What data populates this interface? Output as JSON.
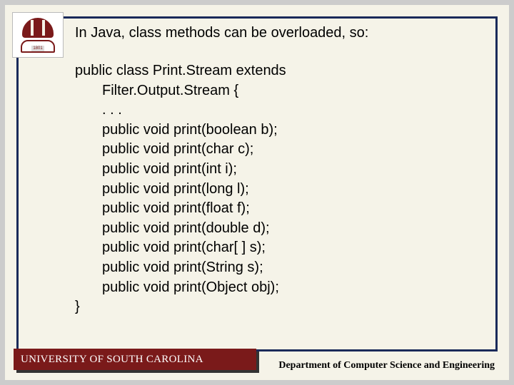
{
  "logo": {
    "year": "1801"
  },
  "intro": "In Java, class methods can be overloaded, so:",
  "code": {
    "decl1": "public class Print.Stream extends",
    "decl2": "Filter.Output.Stream {",
    "dots": ". . .",
    "lines": [
      "public void print(boolean b);",
      "public void print(char c);",
      "public void print(int i);",
      "public void print(long l);",
      "public void print(float f);",
      "public void print(double d);",
      "public void print(char[ ] s);",
      "public void print(String s);",
      "public void print(Object obj);"
    ],
    "close": "}"
  },
  "footer": {
    "left": "UNIVERSITY OF SOUTH CAROLINA",
    "right": "Department of Computer Science and Engineering"
  }
}
